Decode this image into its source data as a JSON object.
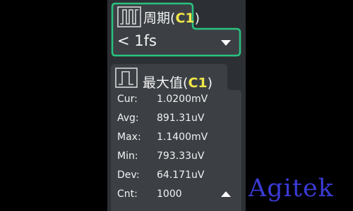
{
  "period": {
    "title": "周期",
    "channel": "C1",
    "value": "< 1fs",
    "icon": "period-pulse-icon",
    "border_color": "#29c27f"
  },
  "statistics": {
    "title": "最大值",
    "channel": "C1",
    "icon": "pulse-icon",
    "rows": [
      {
        "label": "Cur:",
        "value": "1.0200mV"
      },
      {
        "label": "Avg:",
        "value": "891.31uV"
      },
      {
        "label": "Max:",
        "value": "1.1400mV"
      },
      {
        "label": "Min:",
        "value": "793.33uV"
      },
      {
        "label": "Dev:",
        "value": "64.171uV"
      },
      {
        "label": "Cnt:",
        "value": "1000"
      }
    ]
  },
  "watermark": "Agitek",
  "colors": {
    "accent": "#29c27f",
    "channel": "#f1e64a",
    "panel": "#2c2f33",
    "tile": "#3c4045"
  }
}
